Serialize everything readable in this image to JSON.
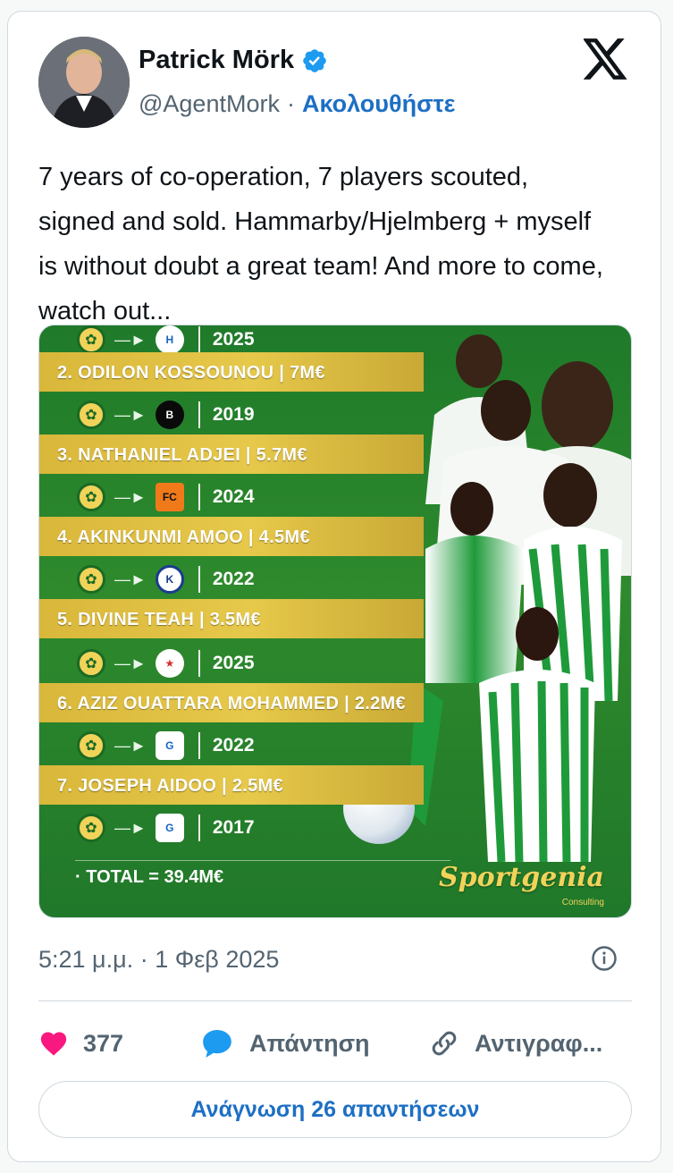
{
  "author": {
    "name": "Patrick Mörk",
    "handle": "@AgentMork",
    "follow_label": "Ακολουθήστε"
  },
  "tweet": {
    "text": "7 years of co-operation, 7 players scouted, signed and sold. Hammarby/Hjelmberg + myself is without doubt a great team! And more to come, watch out..."
  },
  "media": {
    "entries": [
      {
        "label": "",
        "year": "2025"
      },
      {
        "label": "2. ODILON KOSSOUNOU | 7M€",
        "year": "2019"
      },
      {
        "label": "3. NATHANIEL ADJEI | 5.7M€",
        "year": "2024"
      },
      {
        "label": "4. AKINKUNMI AMOO | 4.5M€",
        "year": "2022"
      },
      {
        "label": "5. DIVINE TEAH | 3.5M€",
        "year": "2025"
      },
      {
        "label": "6. AZIZ OUATTARA MOHAMMED | 2.2M€",
        "year": "2022"
      },
      {
        "label": "7. JOSEPH AIDOO | 2.5M€",
        "year": "2017"
      }
    ],
    "total": "· TOTAL = 39.4M€",
    "brand": "Sportgenia",
    "brand_sub": "Consulting"
  },
  "meta": {
    "time": "5:21 μ.μ.",
    "separator": "·",
    "date": "1 Φεβ 2025"
  },
  "actions": {
    "likes": "377",
    "reply_label": "Απάντηση",
    "copy_label": "Αντιγραφ..."
  },
  "read_replies_label": "Ανάγνωση 26 απαντήσεων",
  "colors": {
    "brand_blue": "#1d6fc4",
    "like_pink": "#f91880",
    "reply_blue": "#1d9bf0",
    "pitch_green": "#2e8a2c",
    "band_gold": "#e6c84a"
  }
}
